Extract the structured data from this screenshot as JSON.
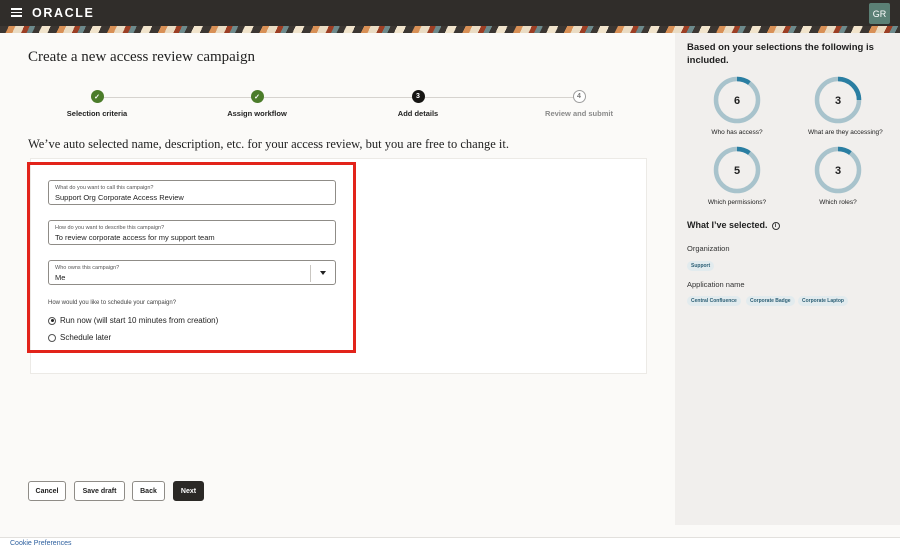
{
  "header": {
    "brand": "ORACLE",
    "avatar_initials": "GR",
    "menu_icon": "hamburger-menu-icon"
  },
  "page": {
    "title": "Create a new access review campaign",
    "intro": "We’ve auto selected name, description, etc. for your access review, but you are free to change it."
  },
  "stepper": {
    "steps": [
      {
        "label": "Selection criteria",
        "state": "done",
        "marker": "✓"
      },
      {
        "label": "Assign workflow",
        "state": "done",
        "marker": "✓"
      },
      {
        "label": "Add details",
        "state": "current",
        "marker": "3"
      },
      {
        "label": "Review and submit",
        "state": "pending",
        "marker": "4"
      }
    ]
  },
  "form": {
    "name": {
      "label": "What do you want to call this campaign?",
      "value": "Support Org Corporate Access Review"
    },
    "description": {
      "label": "How do you want to describe this campaign?",
      "value": "To review corporate access for my support team"
    },
    "owner": {
      "label": "Who owns this campaign?",
      "value": "Me"
    },
    "schedule": {
      "label": "How would you like to schedule your campaign?",
      "options": [
        {
          "label": "Run now (will start 10 minutes from creation)",
          "selected": true
        },
        {
          "label": "Schedule later",
          "selected": false
        }
      ]
    }
  },
  "actions": {
    "cancel": "Cancel",
    "save_draft": "Save draft",
    "back": "Back",
    "next": "Next"
  },
  "summary": {
    "title": "Based on your selections the following is included.",
    "stats": [
      {
        "value": "6",
        "label": "Who has access?",
        "fill": 0.1
      },
      {
        "value": "3",
        "label": "What are they accessing?",
        "fill": 0.25
      },
      {
        "value": "5",
        "label": "Which permissions?",
        "fill": 0.1
      },
      {
        "value": "3",
        "label": "Which roles?",
        "fill": 0.1
      }
    ],
    "selected_title": "What I’ve selected.",
    "info_icon": "i",
    "organization_label": "Organization",
    "organization_chips": [
      "Support"
    ],
    "application_label": "Application name",
    "application_chips": [
      "Central Confluence",
      "Corporate Badge",
      "Corporate Laptop"
    ]
  },
  "colors": {
    "donut_track": "#a8c3cc",
    "donut_fill": "#2a7ea2",
    "highlight": "#e2231a",
    "done": "#4b7c2a"
  },
  "footer": {
    "cookie": "Cookie Preferences"
  }
}
